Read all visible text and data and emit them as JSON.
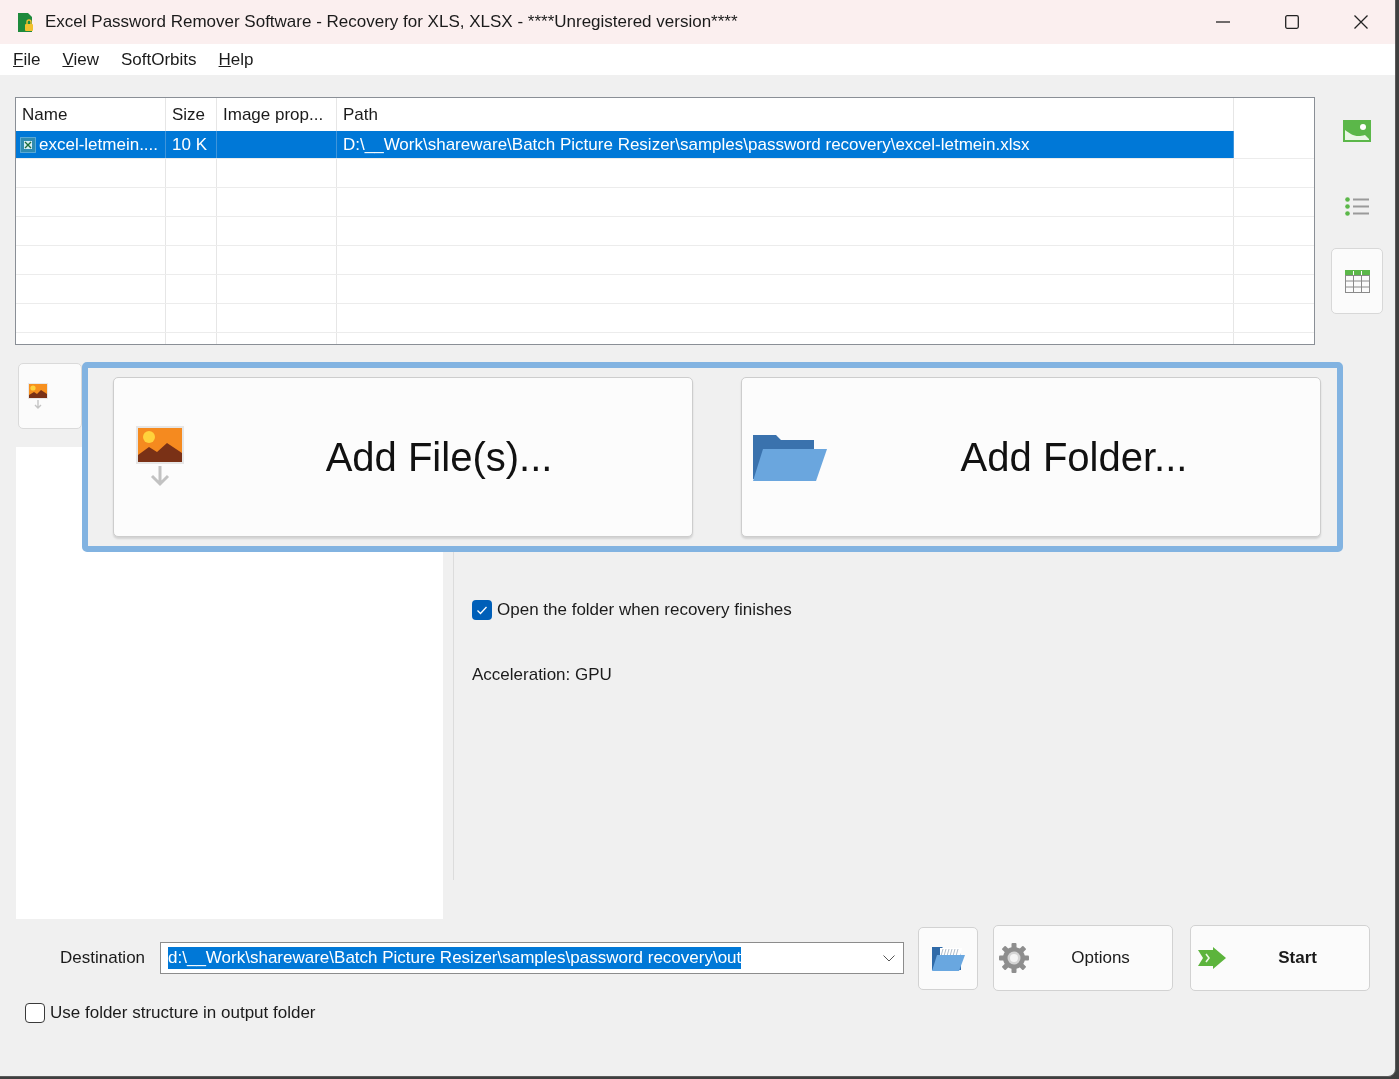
{
  "window": {
    "title": "Excel Password Remover Software - Recovery for XLS, XLSX - ****Unregistered version****"
  },
  "menu": [
    {
      "label": "File",
      "access_key": true
    },
    {
      "label": "View",
      "access_key": true
    },
    {
      "label": "SoftOrbits",
      "access_key": false
    },
    {
      "label": "Help",
      "access_key": true
    }
  ],
  "file_table": {
    "columns": [
      "Name",
      "Size",
      "Image prop...",
      "Path"
    ],
    "rows": [
      {
        "name": "excel-letmein....",
        "size": "10 K",
        "path": "D:\\__Work\\shareware\\Batch Picture Resizer\\samples\\password recovery\\excel-letmein.xlsx",
        "selected": true
      }
    ]
  },
  "view_modes": [
    {
      "kind": "thumbnails",
      "selected": false
    },
    {
      "kind": "list",
      "selected": false
    },
    {
      "kind": "table",
      "selected": true
    }
  ],
  "add_popup": {
    "buttons": [
      {
        "kind": "files",
        "label": "Add File(s)..."
      },
      {
        "kind": "folder",
        "label": "Add Folder..."
      }
    ]
  },
  "settings": {
    "open_folder": {
      "label": "Open the folder when recovery finishes",
      "checked": true
    },
    "acceleration": "Acceleration: GPU"
  },
  "destination": {
    "label": "Destination",
    "value": "d:\\__Work\\shareware\\Batch Picture Resizer\\samples\\password recovery\\out"
  },
  "actions": [
    {
      "kind": "browse"
    },
    {
      "kind": "options",
      "label": "Options"
    },
    {
      "kind": "start",
      "label": "Start"
    }
  ],
  "use_folder_structure": {
    "label": "Use folder structure in output folder",
    "checked": false
  }
}
